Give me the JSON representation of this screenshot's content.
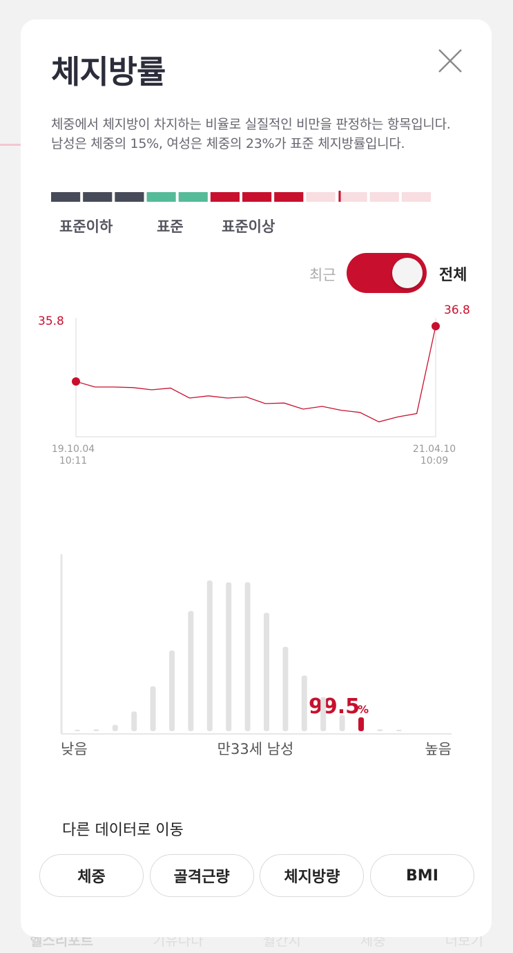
{
  "background": {
    "nav_items": [
      "헬스리포트",
      "기유나다",
      "월간지",
      "체중",
      "더보기"
    ]
  },
  "modal": {
    "title": "체지방률",
    "close_icon": "close-icon",
    "description": "체중에서 체지방이 차지하는 비율로 실질적인 비만을 판정하는 항목입니다. 남성은 체중의 15%, 여성은 체중의 23%가 표준 체지방률입니다.",
    "scale": {
      "labels": [
        "표준이하",
        "표준",
        "표준이상"
      ],
      "segments": [
        "below",
        "below",
        "below",
        "standard",
        "standard",
        "above",
        "above",
        "above",
        "above-light",
        "above-light",
        "above-light",
        "above-light"
      ],
      "marker_position": 0.76,
      "colors": {
        "below": "#474a59",
        "standard": "#55bb99",
        "above": "#c8102e",
        "above-light": "#f8dde1"
      }
    },
    "toggle": {
      "off_label": "최근",
      "on_label": "전체",
      "state": "on"
    }
  },
  "chart_data": [
    {
      "type": "line",
      "title": "",
      "series": [
        {
          "values": [
            35.8,
            35.7,
            35.7,
            35.69,
            35.65,
            35.68,
            35.5,
            35.54,
            35.5,
            35.52,
            35.4,
            35.41,
            35.3,
            35.35,
            35.28,
            35.24,
            35.07,
            35.16,
            35.22,
            36.8
          ]
        }
      ],
      "start_label": {
        "date": "19.10.04",
        "time": "10:11"
      },
      "end_label": {
        "date": "21.04.10",
        "time": "10:09"
      },
      "first_value_label": "35.8",
      "last_value_label": "36.8",
      "ylim": [
        35.0,
        36.8
      ],
      "color": "#c8102e"
    },
    {
      "type": "bar",
      "title": "",
      "xlabel": "만33세 남성",
      "low_label": "낮음",
      "high_label": "높음",
      "values": [
        0.2,
        1,
        3.5,
        11,
        25,
        45,
        67,
        84,
        83,
        83,
        66,
        47,
        31,
        19,
        9,
        3,
        1,
        0.5
      ],
      "highlight_index": 15,
      "percentile": "99.5",
      "percent_sign": "%",
      "bar_color": "#e2e2e2",
      "highlight_color": "#c8102e"
    }
  ],
  "navigation": {
    "section_title": "다른 데이터로 이동",
    "buttons": [
      "체중",
      "골격근량",
      "체지방량",
      "BMI"
    ]
  }
}
